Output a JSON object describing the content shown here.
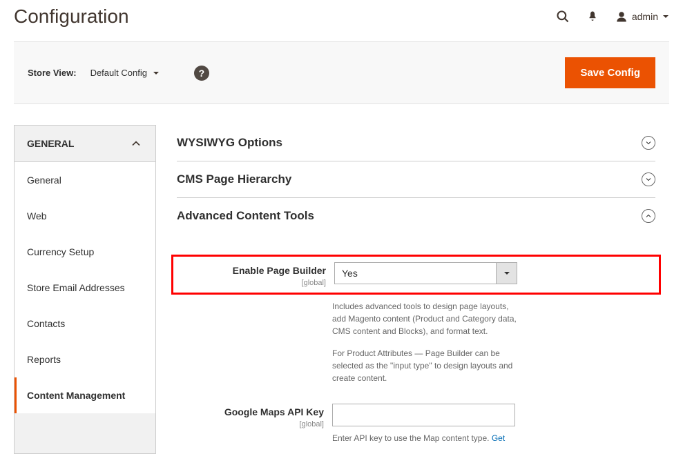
{
  "header": {
    "title": "Configuration",
    "user_label": "admin"
  },
  "toolbar": {
    "store_view_label": "Store View:",
    "store_view_value": "Default Config",
    "save_label": "Save Config"
  },
  "sidebar": {
    "group_title": "GENERAL",
    "items": [
      {
        "label": "General"
      },
      {
        "label": "Web"
      },
      {
        "label": "Currency Setup"
      },
      {
        "label": "Store Email Addresses"
      },
      {
        "label": "Contacts"
      },
      {
        "label": "Reports"
      },
      {
        "label": "Content Management"
      }
    ]
  },
  "sections": {
    "wysiwyg": {
      "title": "WYSIWYG Options"
    },
    "hierarchy": {
      "title": "CMS Page Hierarchy"
    },
    "advanced": {
      "title": "Advanced Content Tools",
      "enable_pb_label": "Enable Page Builder",
      "enable_pb_scope": "[global]",
      "enable_pb_value": "Yes",
      "enable_pb_note1": "Includes advanced tools to design page layouts, add Magento content (Product and Category data, CMS content and Blocks), and format text.",
      "enable_pb_note2": "For Product Attributes — Page Builder can be selected as the \"input type\" to design layouts and create content.",
      "gmaps_label": "Google Maps API Key",
      "gmaps_scope": "[global]",
      "gmaps_value": "",
      "gmaps_note": "Enter API key to use the Map content type. ",
      "gmaps_note_link": "Get"
    }
  }
}
